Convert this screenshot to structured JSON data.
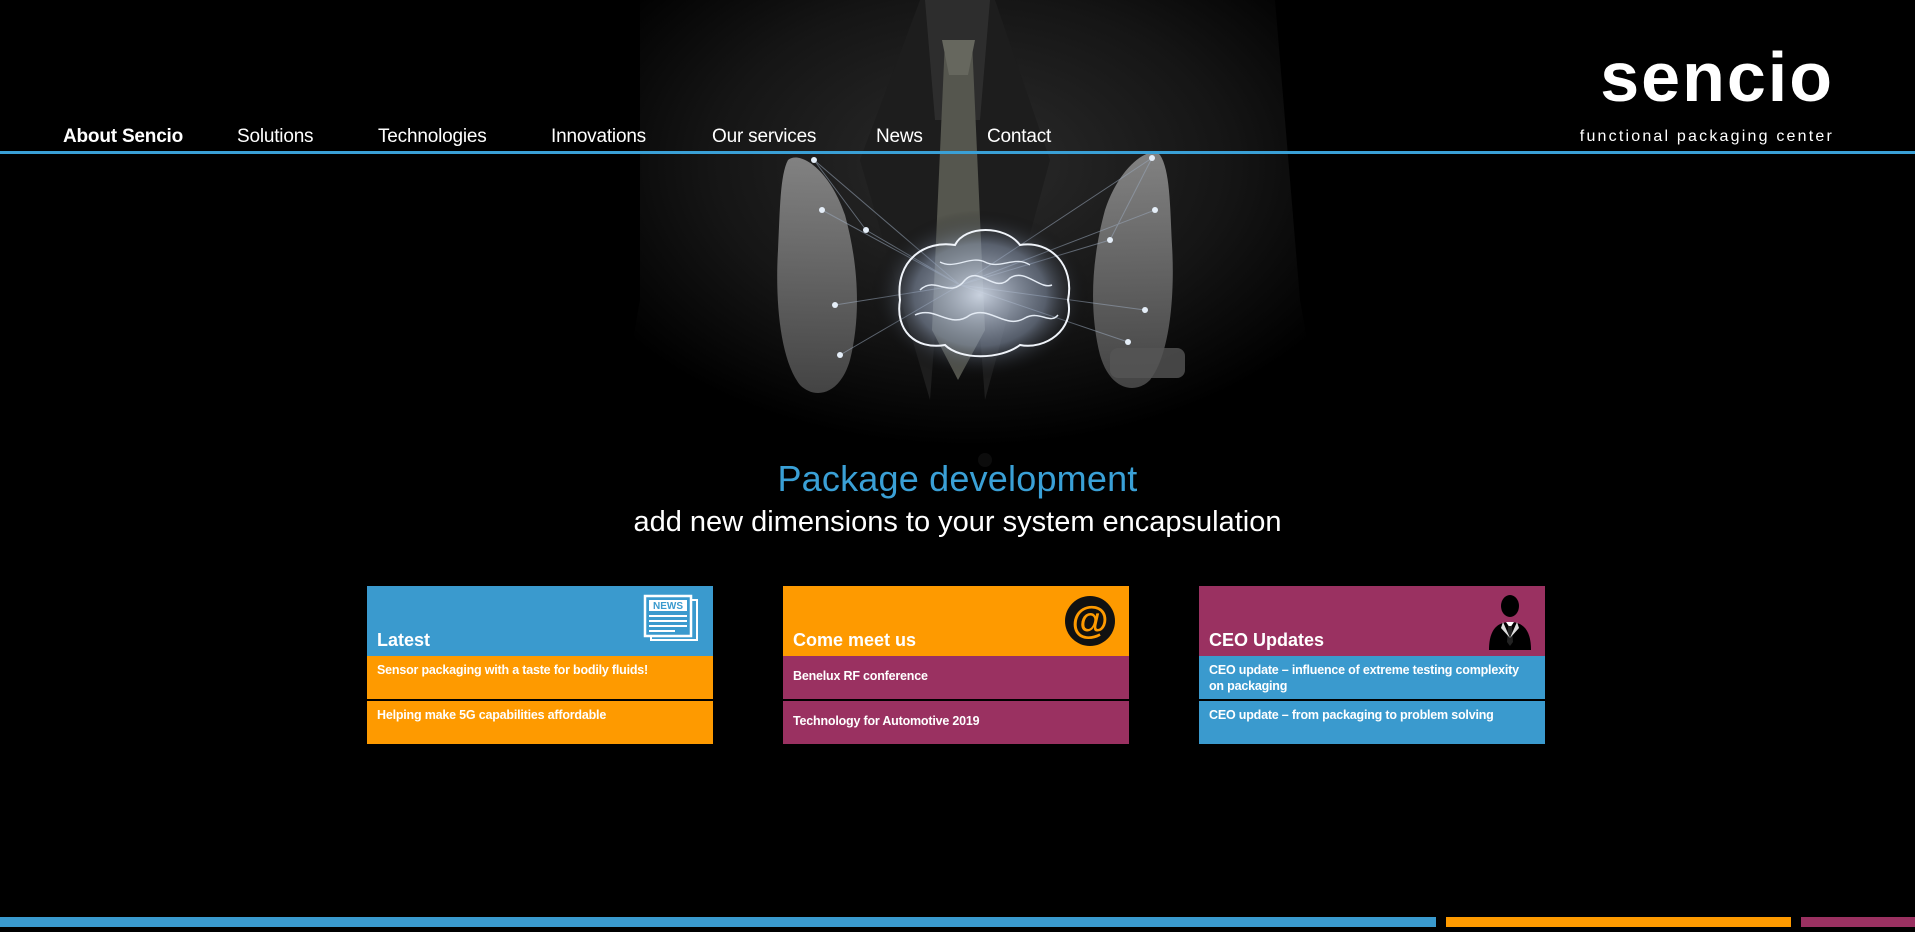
{
  "colors": {
    "accent_blue": "#3a9ace",
    "accent_orange": "#fe9a00",
    "accent_purple": "#9a3161",
    "nav_line": "#3aa0d6",
    "background": "#000000"
  },
  "nav": {
    "items": [
      {
        "label": "About Sencio",
        "active": true
      },
      {
        "label": "Solutions"
      },
      {
        "label": "Technologies"
      },
      {
        "label": "Innovations"
      },
      {
        "label": "Our services"
      },
      {
        "label": "News"
      },
      {
        "label": "Contact"
      }
    ]
  },
  "logo": {
    "word": "sencio",
    "tagline": "functional packaging center"
  },
  "hero": {
    "headline": "Package development",
    "subline": "add new dimensions to your system encapsulation",
    "image": "businessman-hands-holding-glowing-brain"
  },
  "cards": [
    {
      "title": "Latest",
      "icon": "newspaper-icon",
      "icon_text": "NEWS",
      "items": [
        "Sensor packaging with a taste for bodily fluids!",
        "Helping make 5G capabilities affordable"
      ]
    },
    {
      "title": "Come meet us",
      "icon": "at-sign-icon",
      "icon_text": "@",
      "items": [
        "Benelux RF conference",
        "Technology for Automotive 2019"
      ]
    },
    {
      "title": "CEO Updates",
      "icon": "businessman-silhouette-icon",
      "items": [
        "CEO update – influence of extreme testing complexity on packaging",
        "CEO update – from packaging to problem solving"
      ]
    }
  ]
}
